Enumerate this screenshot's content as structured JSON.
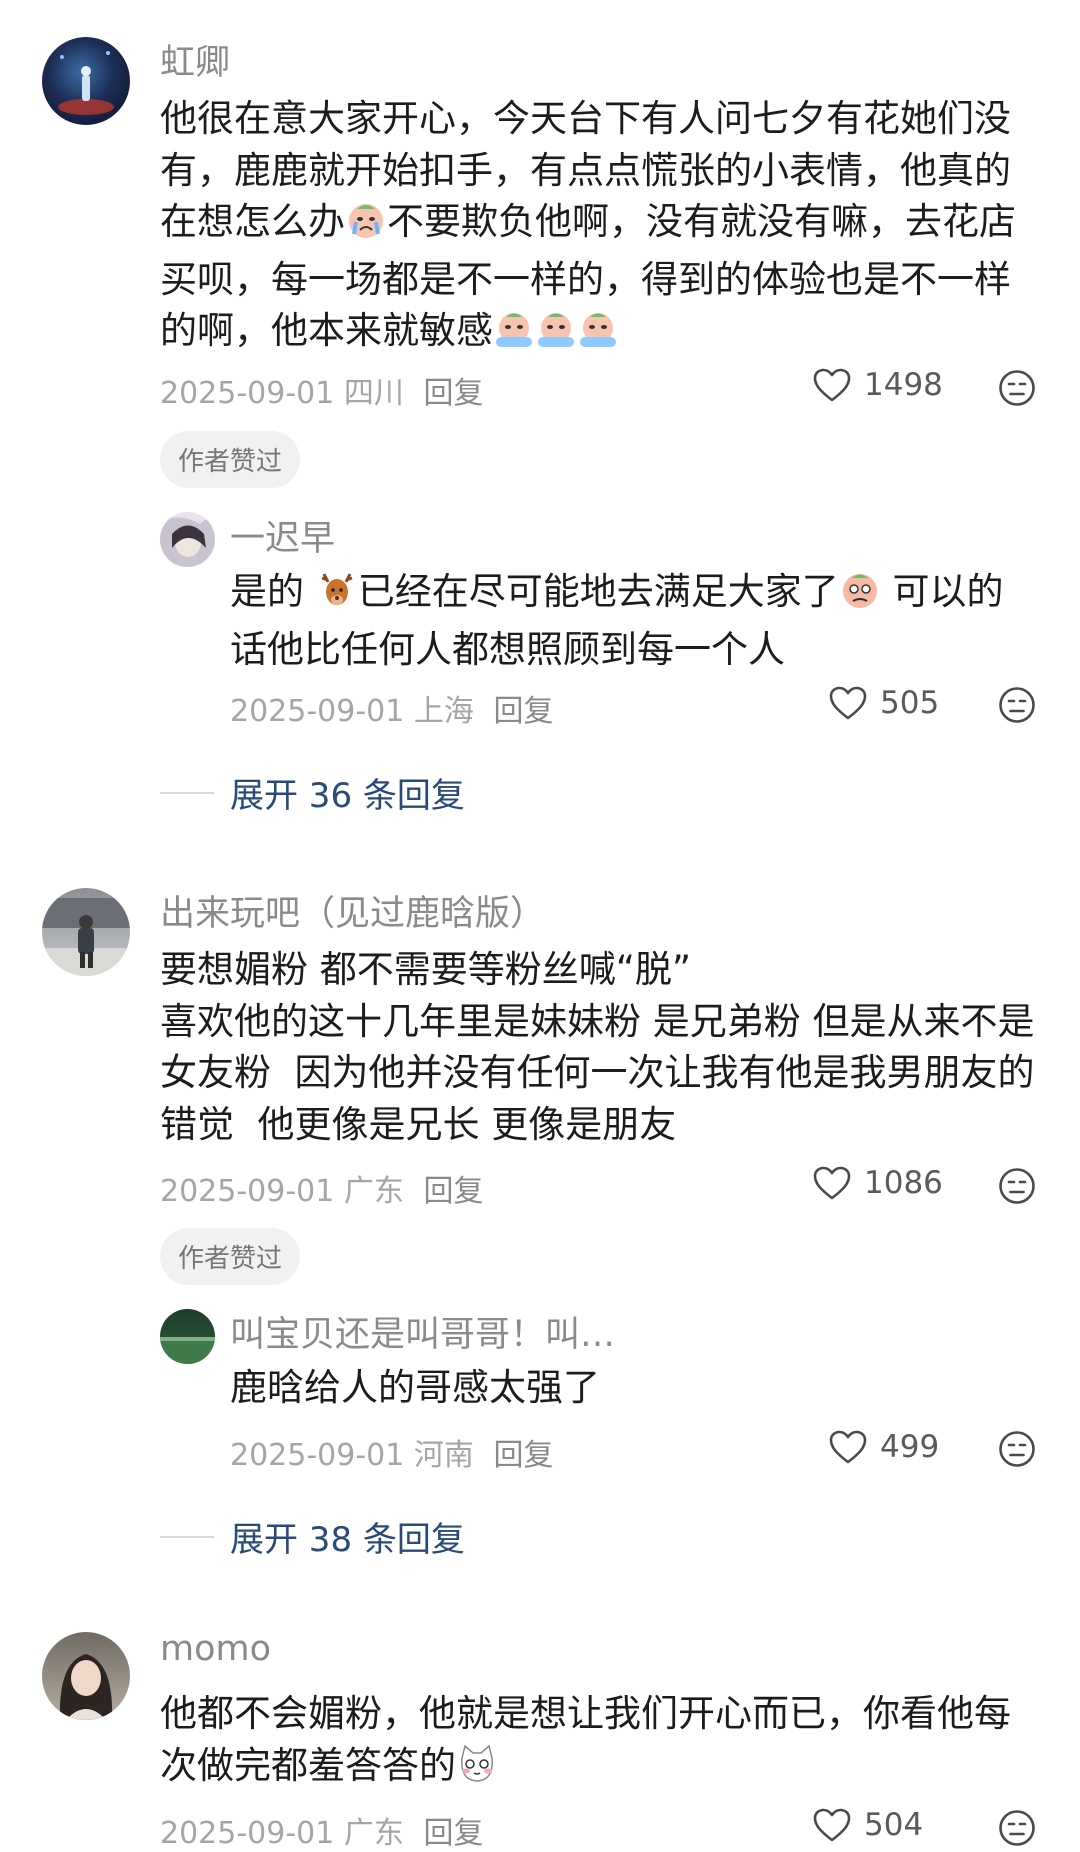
{
  "comments": [
    {
      "username": "虹卿",
      "text_parts": [
        "他很在意大家开心，今天台下有人问七夕有花她们没有，鹿鹿就开始扣手，有点点慌张的小表情，他真的在想怎么办",
        "不要欺负他啊，没有就没有嘛，去花店买呗，每一场都是不一样的，得到的体验也是不一样的啊，他本来就敏感"
      ],
      "date": "2025-09-01",
      "location": "四川",
      "reply_label": "回复",
      "likes": "1498",
      "badge": "作者赞过",
      "sub_reply": {
        "username": "一迟早",
        "text_parts": [
          "是的",
          "已经在尽可能地去满足大家了",
          " 可以的话他比任何人都想照顾到每一个人"
        ],
        "date": "2025-09-01",
        "location": "上海",
        "reply_label": "回复",
        "likes": "505"
      },
      "expand_label": "展开 36 条回复"
    },
    {
      "username": "出来玩吧（见过鹿晗版）",
      "text": "要想媚粉 都不需要等粉丝喊“脱”\n喜欢他的这十几年里是妹妹粉 是兄弟粉 但是从来不是女友粉  因为他并没有任何一次让我有他是我男朋友的错觉  他更像是兄长 更像是朋友",
      "date": "2025-09-01",
      "location": "广东",
      "reply_label": "回复",
      "likes": "1086",
      "badge": "作者赞过",
      "sub_reply": {
        "username": "叫宝贝还是叫哥哥！叫…",
        "text": "鹿晗给人的哥感太强了",
        "date": "2025-09-01",
        "location": "河南",
        "reply_label": "回复",
        "likes": "499"
      },
      "expand_label": "展开 38 条回复"
    },
    {
      "username": "momo",
      "text_parts": [
        "他都不会媚粉，他就是想让我们开心而已，你看他每次做完都羞答答的"
      ],
      "date": "2025-09-01",
      "location": "广东",
      "reply_label": "回复",
      "likes": "504"
    }
  ],
  "icons": {
    "like": "heart-outline-icon",
    "dislike": "unhappy-face-icon"
  },
  "colors": {
    "expand_link": "#284b78",
    "meta": "#a5a5a5"
  }
}
